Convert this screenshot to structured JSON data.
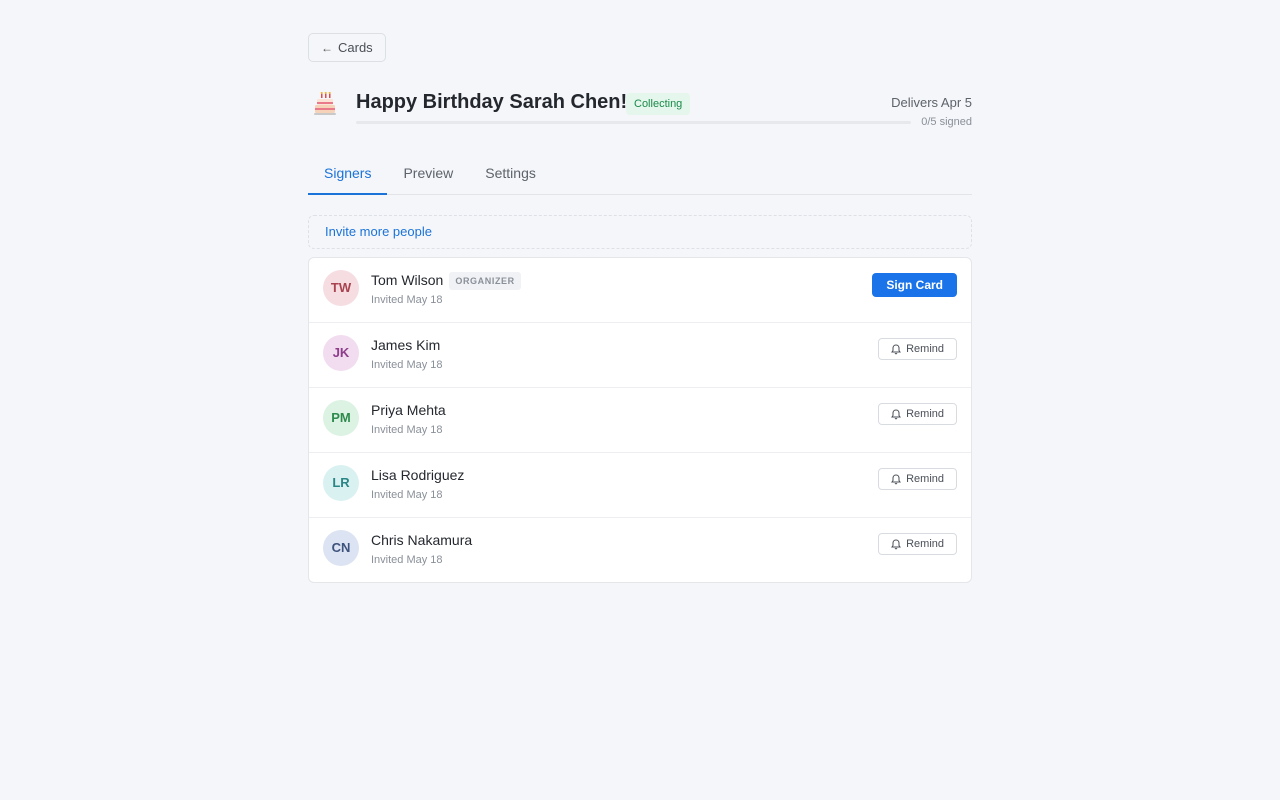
{
  "nav": {
    "back_label": "Cards"
  },
  "card": {
    "title": "Happy Birthday Sarah Chen!",
    "status": "Collecting",
    "delivery": "Delivers Apr 5",
    "signed_label": "0/5 signed",
    "signed_fraction": 0
  },
  "tabs": [
    {
      "label": "Signers",
      "active": true
    },
    {
      "label": "Preview",
      "active": false
    },
    {
      "label": "Settings",
      "active": false
    }
  ],
  "invite_label": "Invite more people",
  "signers": [
    {
      "initials": "TW",
      "name": "Tom Wilson",
      "role": "ORGANIZER",
      "invited": "Invited May 18",
      "action": "Sign Card",
      "avatar_bg": "#f6dde2",
      "avatar_fg": "#a8434f"
    },
    {
      "initials": "JK",
      "name": "James Kim",
      "role": "",
      "invited": "Invited May 18",
      "action": "Remind",
      "avatar_bg": "#f1dcf0",
      "avatar_fg": "#8d3d8a"
    },
    {
      "initials": "PM",
      "name": "Priya Mehta",
      "role": "",
      "invited": "Invited May 18",
      "action": "Remind",
      "avatar_bg": "#dcf2e2",
      "avatar_fg": "#2d8a4c"
    },
    {
      "initials": "LR",
      "name": "Lisa Rodriguez",
      "role": "",
      "invited": "Invited May 18",
      "action": "Remind",
      "avatar_bg": "#d9f1f1",
      "avatar_fg": "#2a8686"
    },
    {
      "initials": "CN",
      "name": "Chris Nakamura",
      "role": "",
      "invited": "Invited May 18",
      "action": "Remind",
      "avatar_bg": "#dce3f2",
      "avatar_fg": "#3d527d"
    }
  ],
  "colors": {
    "accent": "#1a73e8",
    "status_green": "#1a8a4a"
  }
}
